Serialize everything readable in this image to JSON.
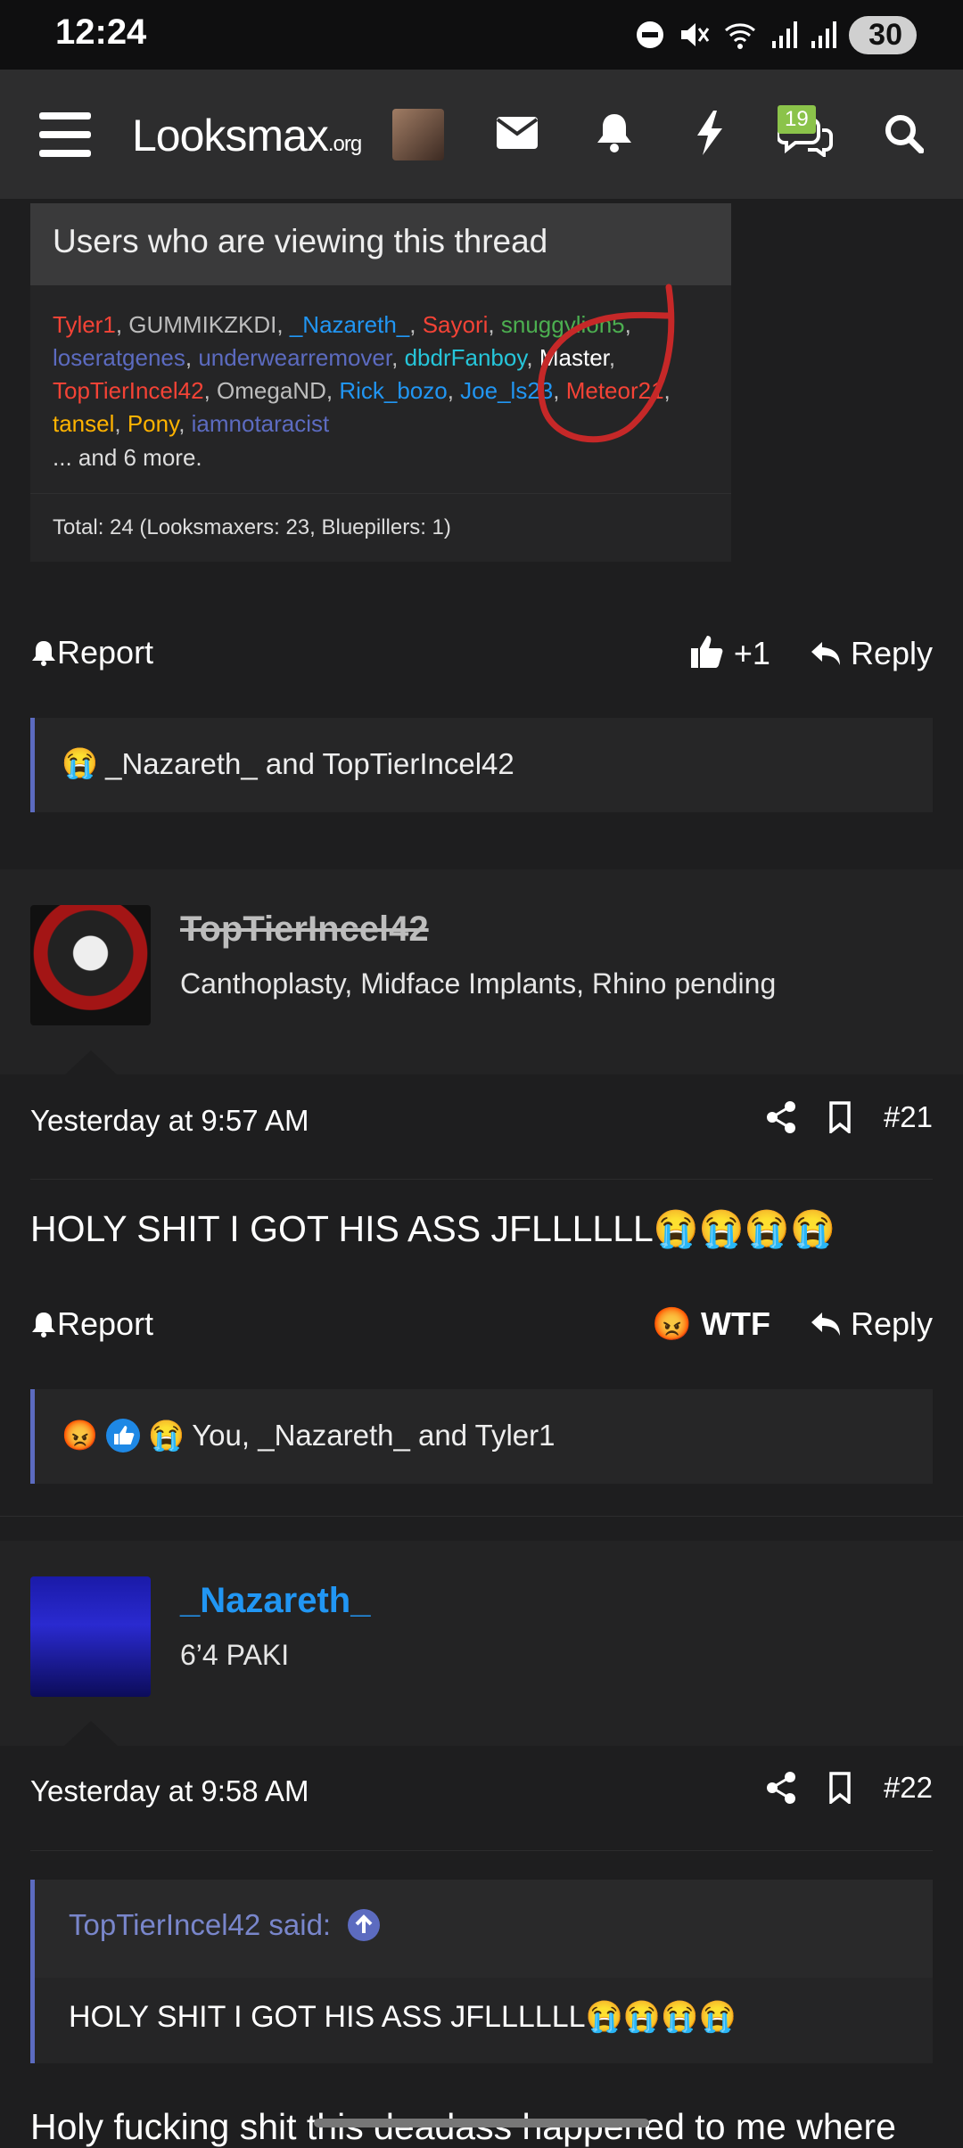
{
  "status_bar": {
    "time": "12:24",
    "battery": "30"
  },
  "nav": {
    "logo_main": "Looksmax",
    "logo_suffix": ".org",
    "conversations_badge": "19"
  },
  "viewers_panel": {
    "title": "Users who are viewing this thread",
    "users": [
      {
        "name": "Tyler1",
        "color": "#f44336"
      },
      {
        "name": "GUMMIKZKDI",
        "color": "#bdbdbd"
      },
      {
        "name": "_Nazareth_",
        "color": "#2196f3"
      },
      {
        "name": "Sayori",
        "color": "#f44336"
      },
      {
        "name": "snuggylion5",
        "color": "#4caf50"
      },
      {
        "name": "loseratgenes",
        "color": "#5c6bc0"
      },
      {
        "name": "underwearremover",
        "color": "#5c6bc0"
      },
      {
        "name": "dbdrFanboy",
        "color": "#26c6da"
      },
      {
        "name": "Master",
        "color": "#ffffff"
      },
      {
        "name": "TopTierIncel42",
        "color": "#f44336"
      },
      {
        "name": "OmegaND",
        "color": "#bdbdbd"
      },
      {
        "name": "Rick_bozo",
        "color": "#2196f3"
      },
      {
        "name": "Joe_ls23",
        "color": "#2196f3"
      },
      {
        "name": "Meteor21",
        "color": "#f44336"
      },
      {
        "name": "tansel",
        "color": "#ffb300"
      },
      {
        "name": "Pony",
        "color": "#ffb300"
      },
      {
        "name": "iamnotaracist",
        "color": "#5c6bc0"
      }
    ],
    "more": "... and 6 more.",
    "total": "Total: 24 (Looksmaxers: 23, Bluepillers: 1)"
  },
  "post20": {
    "report": "Report",
    "like": "+1",
    "reply": "Reply",
    "reactions": "_Nazareth_ and TopTierIncel42"
  },
  "post21": {
    "author": "TopTierIncel42",
    "author_title": "Canthoplasty, Midface Implants, Rhino pending",
    "date": "Yesterday at 9:57 AM",
    "number": "#21",
    "text": "HOLY SHIT I GOT HIS ASS JFLLLLLL😭😭😭😭",
    "report": "Report",
    "reaction": "WTF",
    "reply": "Reply",
    "reactions": "You, _Nazareth_ and Tyler1"
  },
  "post22": {
    "author": "_Nazareth_",
    "author_title": "6’4 PAKI",
    "date": "Yesterday at 9:58 AM",
    "number": "#22",
    "quote_author": "TopTierIncel42 said:",
    "quote_text": "HOLY SHIT I GOT HIS ASS JFLLLLLL😭😭😭😭",
    "text": "Holy fucking shit this deadass happened to me where"
  }
}
